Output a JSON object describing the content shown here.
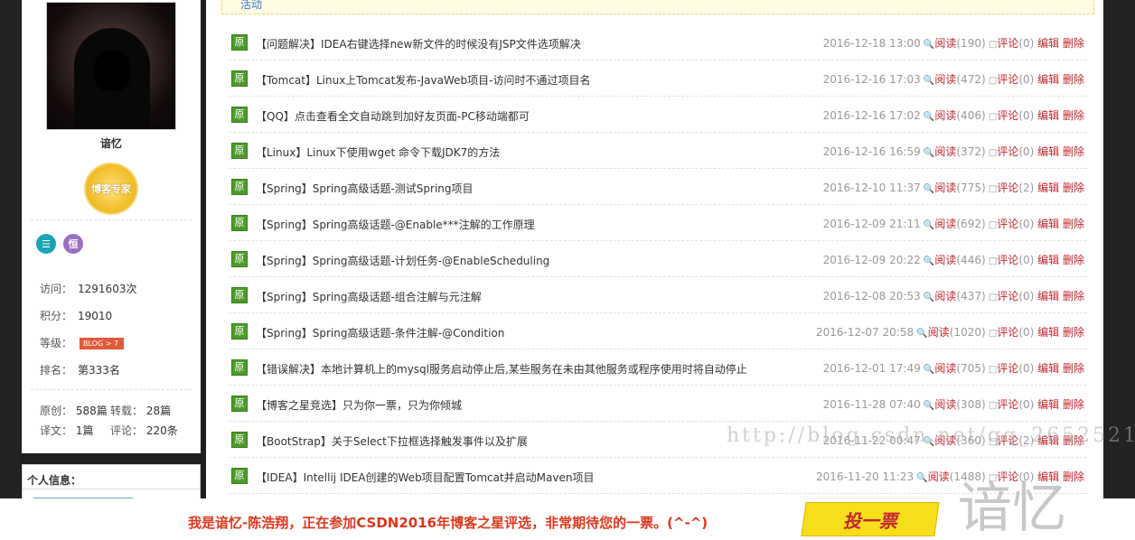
{
  "sidebar": {
    "username": "谙忆",
    "medal_label": "博客专家",
    "badge_icons": [
      "list-icon",
      "heng-icon"
    ],
    "badge_icon_glyphs": [
      "☰",
      "恒"
    ],
    "badge_icon_colors": [
      "#1aa4b5",
      "#9b6fbf"
    ],
    "stats": {
      "visits_label": "访问：",
      "visits_value": "1291603次",
      "points_label": "积分：",
      "points_value": "19010",
      "level_label": "等级：",
      "level_badge": "BLOG > 7",
      "rank_label": "排名：",
      "rank_value": "第333名"
    },
    "article_counts": {
      "original_label": "原创：",
      "original_value": "588篇",
      "repost_label": "转载：",
      "repost_value": "28篇",
      "translated_label": "译文：",
      "translated_value": "1篇",
      "comments_label": "评论：",
      "comments_value": "220条"
    },
    "personal_info_header": "个人信息："
  },
  "notice": {
    "text": "活动"
  },
  "labels": {
    "original_tag": "原",
    "read": "阅读",
    "comment": "评论",
    "edit": "编辑",
    "delete": "删除"
  },
  "articles": [
    {
      "title": "【问题解决】IDEA右键选择new新文件的时候没有JSP文件选项解决",
      "date": "2016-12-18 13:00",
      "reads": "(190)",
      "comments": "(0)"
    },
    {
      "title": "【Tomcat】Linux上Tomcat发布-JavaWeb项目-访问时不通过项目名",
      "date": "2016-12-16 17:03",
      "reads": "(472)",
      "comments": "(0)"
    },
    {
      "title": "【QQ】点击查看全文自动跳到加好友页面-PC移动端都可",
      "date": "2016-12-16 17:02",
      "reads": "(406)",
      "comments": "(0)"
    },
    {
      "title": "【Linux】Linux下使用wget 命令下载JDK7的方法",
      "date": "2016-12-16 16:59",
      "reads": "(372)",
      "comments": "(0)"
    },
    {
      "title": "【Spring】Spring高级话题-测试Spring项目",
      "date": "2016-12-10 11:37",
      "reads": "(775)",
      "comments": "(2)"
    },
    {
      "title": "【Spring】Spring高级话题-@Enable***注解的工作原理",
      "date": "2016-12-09 21:11",
      "reads": "(692)",
      "comments": "(0)"
    },
    {
      "title": "【Spring】Spring高级话题-计划任务-@EnableScheduling",
      "date": "2016-12-09 20:22",
      "reads": "(446)",
      "comments": "(0)"
    },
    {
      "title": "【Spring】Spring高级话题-组合注解与元注解",
      "date": "2016-12-08 20:53",
      "reads": "(437)",
      "comments": "(0)"
    },
    {
      "title": "【Spring】Spring高级话题-条件注解-@Condition",
      "date": "2016-12-07 20:58",
      "reads": "(1020)",
      "comments": "(0)"
    },
    {
      "title": "【错误解决】本地计算机上的mysql服务启动停止后,某些服务在未由其他服务或程序使用时将自动停止",
      "date": "2016-12-01 17:49",
      "reads": "(705)",
      "comments": "(0)"
    },
    {
      "title": "【博客之星竞选】只为你一票，只为你倾城",
      "date": "2016-11-28 07:40",
      "reads": "(308)",
      "comments": "(0)"
    },
    {
      "title": "【BootStrap】关于Select下拉框选择触发事件以及扩展",
      "date": "2016-11-22 00:47",
      "reads": "(360)",
      "comments": "(2)"
    },
    {
      "title": "【IDEA】Intellij IDEA创建的Web项目配置Tomcat并启动Maven项目",
      "date": "2016-11-20 11:23",
      "reads": "(1488)",
      "comments": "(0)"
    }
  ],
  "vote": {
    "text": "我是谙忆-陈浩翔，正在参加CSDN2016年博客之星评选，非常期待您的一票。(^-^)",
    "button": "投一票"
  },
  "watermark": {
    "name": "谙忆",
    "url": "http://blog.csdn.net/qq_26525215"
  }
}
